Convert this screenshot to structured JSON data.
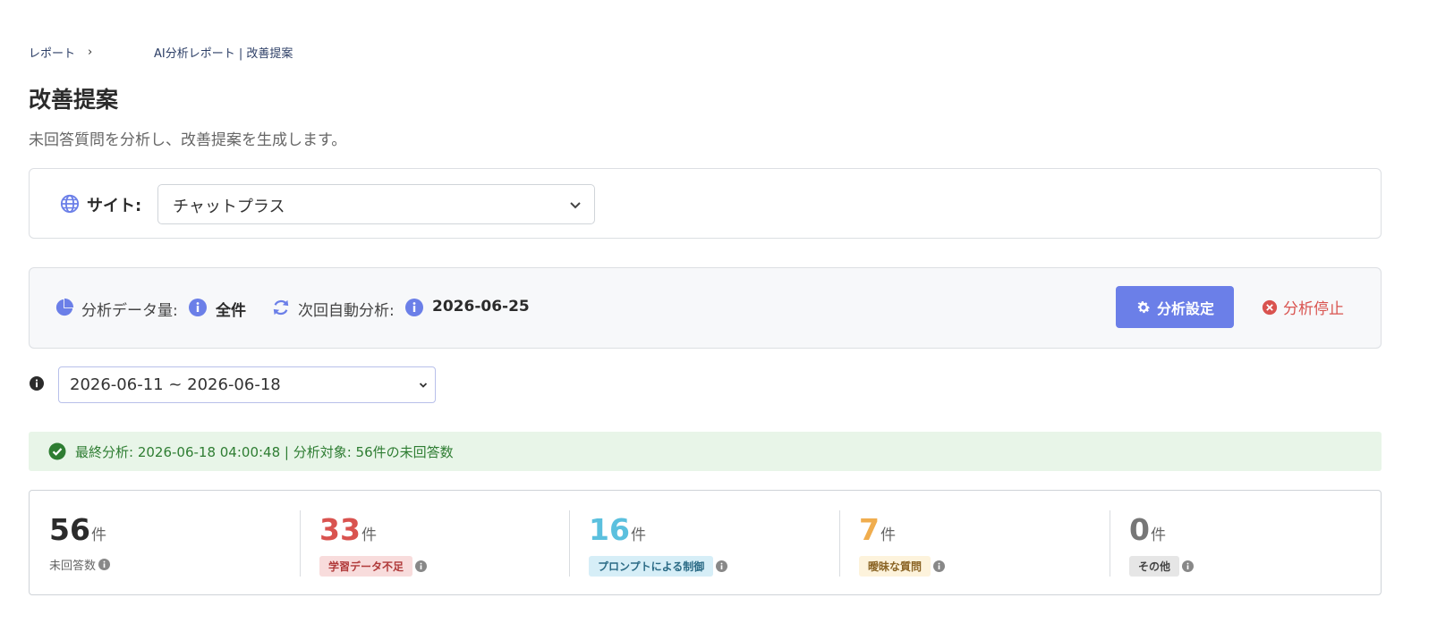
{
  "breadcrumb": {
    "parent": "レポート",
    "separator": "›",
    "current": "AI分析レポート | 改善提案"
  },
  "page": {
    "title": "改善提案",
    "description": "未回答質問を分析し、改善提案を生成します。"
  },
  "site": {
    "label": "サイト:",
    "selected": "チャットプラス"
  },
  "analysis": {
    "data_amount_label": "分析データ量:",
    "data_amount_value": "全件",
    "next_auto_label": "次回自動分析:",
    "next_auto_value": "2026-06-25",
    "settings_button": "分析設定",
    "stop_button": "分析停止"
  },
  "period": {
    "selected": "2026-06-11 ~ 2026-06-18"
  },
  "status": {
    "message": "最終分析: 2026-06-18 04:00:48 | 分析対象: 56件の未回答数"
  },
  "stats": [
    {
      "value": "56",
      "unit": "件",
      "label": "未回答数",
      "color": "#2b2b2b",
      "tag_bg": "",
      "tag_fg": ""
    },
    {
      "value": "33",
      "unit": "件",
      "label": "学習データ不足",
      "color": "#d9534f",
      "tag_bg": "#f8dcdc",
      "tag_fg": "#b03a3a"
    },
    {
      "value": "16",
      "unit": "件",
      "label": "プロンプトによる制御",
      "color": "#5bc0de",
      "tag_bg": "#d6eef7",
      "tag_fg": "#2b6b86"
    },
    {
      "value": "7",
      "unit": "件",
      "label": "曖昧な質問",
      "color": "#f0ad4e",
      "tag_bg": "#fdf3dc",
      "tag_fg": "#8a6424"
    },
    {
      "value": "0",
      "unit": "件",
      "label": "その他",
      "color": "#777777",
      "tag_bg": "#e6e6e6",
      "tag_fg": "#444444"
    }
  ],
  "colors": {
    "primary": "#6b7fe8",
    "danger": "#d9534f",
    "success": "#2e7d32",
    "icon_blue": "#6b7fe8"
  }
}
